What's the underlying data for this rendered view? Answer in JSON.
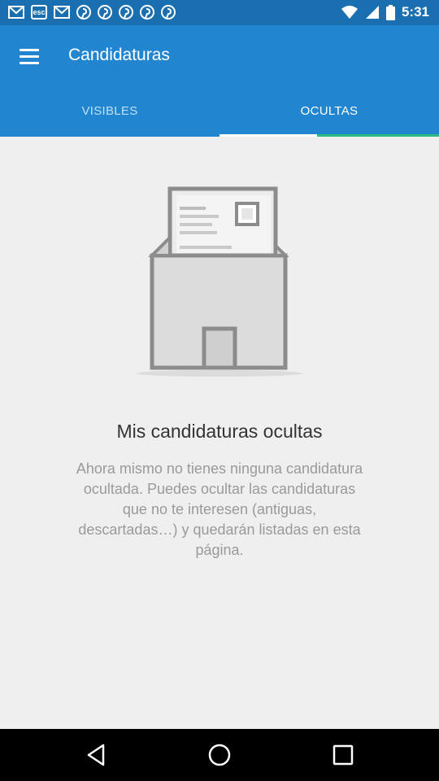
{
  "status_bar": {
    "time": "5:31",
    "icons": [
      "mail-icon",
      "esc-icon",
      "mail-icon",
      "pinterest-icon",
      "pinterest-icon",
      "pinterest-icon",
      "pinterest-icon",
      "pinterest-icon",
      "wifi-icon",
      "signal-icon",
      "battery-icon"
    ],
    "esc_label": "esc"
  },
  "app_bar": {
    "title": "Candidaturas",
    "color": "#2185d0"
  },
  "tabs": [
    {
      "label": "VISIBLES",
      "selected": false
    },
    {
      "label": "OCULTAS",
      "selected": true
    }
  ],
  "empty_state": {
    "title": "Mis candidaturas ocultas",
    "message": "Ahora mismo no tienes ninguna candidatura ocultada. Puedes ocultar las candidaturas que no te interesen (antiguas, descartadas…) y quedarán listadas en esta página."
  },
  "nav_bar": {
    "buttons": [
      "back-icon",
      "home-icon",
      "recent-apps-icon"
    ]
  },
  "colors": {
    "status_bar": "#1a6fb0",
    "app_bar": "#2185d0",
    "indicator_green": "#2bbd7e",
    "background": "#efefef"
  }
}
